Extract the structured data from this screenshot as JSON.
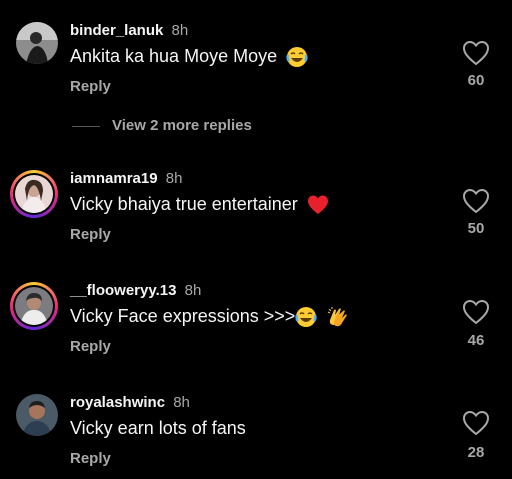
{
  "comments": [
    {
      "username": "binder_lanuk",
      "time": "8h",
      "text": "Ankita ka hua Moye Moye",
      "emojis": [
        "joy-emoji"
      ],
      "reply_label": "Reply",
      "like_count": "60",
      "view_more": "View 2 more replies"
    },
    {
      "username": "iamnamra19",
      "time": "8h",
      "text": "Vicky bhaiya true entertainer",
      "emojis": [
        "red-heart-emoji"
      ],
      "reply_label": "Reply",
      "like_count": "50"
    },
    {
      "username": "__flooweryy.13",
      "time": "8h",
      "text": "Vicky Face expressions >>>",
      "emojis": [
        "joy-emoji",
        "clapping-hands-emoji"
      ],
      "reply_label": "Reply",
      "like_count": "46"
    },
    {
      "username": "royalashwinc",
      "time": "8h",
      "text": "Vicky earn lots of fans",
      "emojis": [],
      "reply_label": "Reply",
      "like_count": "28"
    }
  ],
  "colors": {
    "background": "#000000",
    "primary_text": "#f5f5f5",
    "secondary_text": "#a8a8a8",
    "story_ring": "#ee2a7b"
  },
  "icons": {
    "like": "heart-outline-icon"
  }
}
